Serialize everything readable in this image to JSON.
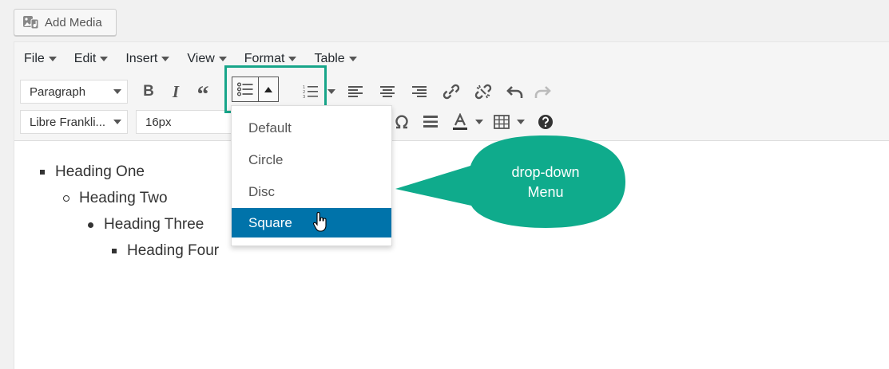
{
  "add_media": {
    "label": "Add Media",
    "icon": "add-media-icon"
  },
  "menubar": [
    {
      "label": "File"
    },
    {
      "label": "Edit"
    },
    {
      "label": "Insert"
    },
    {
      "label": "View"
    },
    {
      "label": "Format"
    },
    {
      "label": "Table"
    }
  ],
  "toolbar": {
    "block_format": "Paragraph",
    "font_family": "Libre Frankli...",
    "font_size": "16px",
    "bold_label": "B",
    "italic_label": "I",
    "quote_label": "“"
  },
  "dropdown": {
    "items": [
      {
        "label": "Default"
      },
      {
        "label": "Circle"
      },
      {
        "label": "Disc"
      },
      {
        "label": "Square",
        "selected": true
      }
    ]
  },
  "content": {
    "list": [
      {
        "text": "Heading One",
        "bullet": "square"
      },
      {
        "text": "Heading Two",
        "bullet": "circle"
      },
      {
        "text": "Heading Three",
        "bullet": "disc"
      },
      {
        "text": "Heading Four",
        "bullet": "square"
      }
    ]
  },
  "callout": {
    "line1": "drop-down",
    "line2": "Menu"
  },
  "colors": {
    "accent": "#17a589",
    "callout": "#0fab8c",
    "selected": "#0073aa"
  }
}
